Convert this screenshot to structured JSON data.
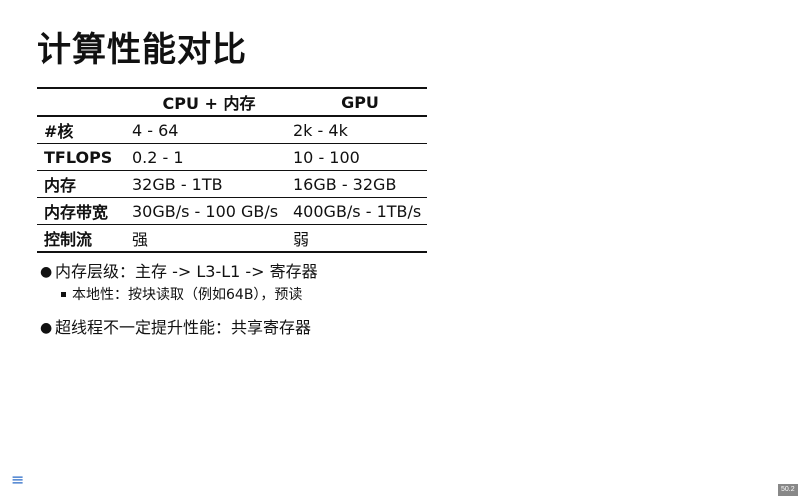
{
  "title": "计算性能对比",
  "table": {
    "headers": [
      "",
      "CPU + 内存",
      "GPU"
    ],
    "rows": [
      [
        "#核",
        "4 - 64",
        "2k - 4k"
      ],
      [
        "TFLOPS",
        "0.2 - 1",
        "10 - 100"
      ],
      [
        "内存",
        "32GB - 1TB",
        "16GB - 32GB"
      ],
      [
        "内存带宽",
        "30GB/s - 100 GB/s",
        "400GB/s - 1TB/s"
      ],
      [
        "控制流",
        "强",
        "弱"
      ]
    ]
  },
  "bullets": [
    {
      "text": "内存层级：主存 -> L3-L1 -> 寄存器",
      "sub": [
        "本地性：按块读取（例如64B），预读"
      ]
    },
    {
      "text": "超线程不一定提升性能：共享寄存器"
    }
  ],
  "footer": {
    "menu_icon": "≡",
    "page_number": "50.2"
  }
}
